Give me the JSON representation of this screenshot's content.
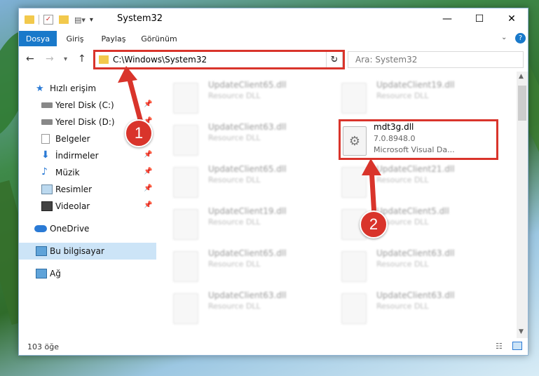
{
  "window": {
    "title": "System32"
  },
  "ribbon": {
    "tabs": [
      "Dosya",
      "Giriş",
      "Paylaş",
      "Görünüm"
    ]
  },
  "address": {
    "path": "C:\\Windows\\System32",
    "search_placeholder": "Ara: System32"
  },
  "nav": {
    "items": [
      {
        "label": "Hızlı erişim",
        "icon": "star-icon",
        "pinned": false
      },
      {
        "label": "Yerel Disk (C:)",
        "icon": "drive-icon",
        "pinned": true
      },
      {
        "label": "Yerel Disk (D:)",
        "icon": "drive-icon",
        "pinned": true
      },
      {
        "label": "Belgeler",
        "icon": "documents-icon",
        "pinned": true
      },
      {
        "label": "İndirmeler",
        "icon": "download-icon",
        "pinned": true
      },
      {
        "label": "Müzik",
        "icon": "music-icon",
        "pinned": true
      },
      {
        "label": "Resimler",
        "icon": "pictures-icon",
        "pinned": true
      },
      {
        "label": "Videolar",
        "icon": "videos-icon",
        "pinned": true
      },
      {
        "label": "OneDrive",
        "icon": "cloud-icon",
        "pinned": false
      },
      {
        "label": "Bu bilgisayar",
        "icon": "computer-icon",
        "pinned": false,
        "selected": true
      },
      {
        "label": "Ağ",
        "icon": "network-icon",
        "pinned": false
      }
    ]
  },
  "files_left": [
    {
      "name": "UpdateClient65.dll",
      "type": "Resource DLL"
    },
    {
      "name": "UpdateClient63.dll",
      "type": "Resource DLL"
    },
    {
      "name": "UpdateClient65.dll",
      "type": "Resource DLL"
    },
    {
      "name": "UpdateClient19.dll",
      "type": "Resource DLL"
    },
    {
      "name": "UpdateClient65.dll",
      "type": "Resource DLL"
    },
    {
      "name": "UpdateClient63.dll",
      "type": "Resource DLL"
    }
  ],
  "files_right": [
    {
      "name": "UpdateClient19.dll",
      "type": "Resource DLL"
    },
    {
      "name": "UpdateClient21.dll",
      "type": "Resource DLL"
    },
    {
      "name": "UpdateClient5.dll",
      "type": "Resource DLL"
    },
    {
      "name": "UpdateClient63.dll",
      "type": "Resource DLL"
    },
    {
      "name": "UpdateClient63.dll",
      "type": "Resource DLL"
    }
  ],
  "highlighted_file": {
    "name": "mdt3g.dll",
    "version": "7.0.8948.0",
    "description": "Microsoft Visual Da..."
  },
  "status": {
    "count": "103 öğe"
  },
  "annotations": {
    "step1": "1",
    "step2": "2",
    "color": "#d9342b"
  }
}
